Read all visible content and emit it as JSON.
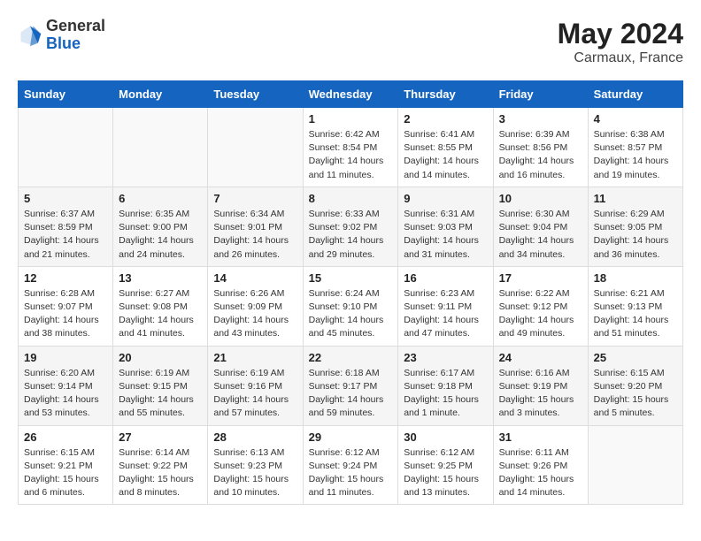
{
  "header": {
    "logo_general": "General",
    "logo_blue": "Blue",
    "month_year": "May 2024",
    "location": "Carmaux, France"
  },
  "weekdays": [
    "Sunday",
    "Monday",
    "Tuesday",
    "Wednesday",
    "Thursday",
    "Friday",
    "Saturday"
  ],
  "weeks": [
    [
      {
        "day": "",
        "info": ""
      },
      {
        "day": "",
        "info": ""
      },
      {
        "day": "",
        "info": ""
      },
      {
        "day": "1",
        "info": "Sunrise: 6:42 AM\nSunset: 8:54 PM\nDaylight: 14 hours\nand 11 minutes."
      },
      {
        "day": "2",
        "info": "Sunrise: 6:41 AM\nSunset: 8:55 PM\nDaylight: 14 hours\nand 14 minutes."
      },
      {
        "day": "3",
        "info": "Sunrise: 6:39 AM\nSunset: 8:56 PM\nDaylight: 14 hours\nand 16 minutes."
      },
      {
        "day": "4",
        "info": "Sunrise: 6:38 AM\nSunset: 8:57 PM\nDaylight: 14 hours\nand 19 minutes."
      }
    ],
    [
      {
        "day": "5",
        "info": "Sunrise: 6:37 AM\nSunset: 8:59 PM\nDaylight: 14 hours\nand 21 minutes."
      },
      {
        "day": "6",
        "info": "Sunrise: 6:35 AM\nSunset: 9:00 PM\nDaylight: 14 hours\nand 24 minutes."
      },
      {
        "day": "7",
        "info": "Sunrise: 6:34 AM\nSunset: 9:01 PM\nDaylight: 14 hours\nand 26 minutes."
      },
      {
        "day": "8",
        "info": "Sunrise: 6:33 AM\nSunset: 9:02 PM\nDaylight: 14 hours\nand 29 minutes."
      },
      {
        "day": "9",
        "info": "Sunrise: 6:31 AM\nSunset: 9:03 PM\nDaylight: 14 hours\nand 31 minutes."
      },
      {
        "day": "10",
        "info": "Sunrise: 6:30 AM\nSunset: 9:04 PM\nDaylight: 14 hours\nand 34 minutes."
      },
      {
        "day": "11",
        "info": "Sunrise: 6:29 AM\nSunset: 9:05 PM\nDaylight: 14 hours\nand 36 minutes."
      }
    ],
    [
      {
        "day": "12",
        "info": "Sunrise: 6:28 AM\nSunset: 9:07 PM\nDaylight: 14 hours\nand 38 minutes."
      },
      {
        "day": "13",
        "info": "Sunrise: 6:27 AM\nSunset: 9:08 PM\nDaylight: 14 hours\nand 41 minutes."
      },
      {
        "day": "14",
        "info": "Sunrise: 6:26 AM\nSunset: 9:09 PM\nDaylight: 14 hours\nand 43 minutes."
      },
      {
        "day": "15",
        "info": "Sunrise: 6:24 AM\nSunset: 9:10 PM\nDaylight: 14 hours\nand 45 minutes."
      },
      {
        "day": "16",
        "info": "Sunrise: 6:23 AM\nSunset: 9:11 PM\nDaylight: 14 hours\nand 47 minutes."
      },
      {
        "day": "17",
        "info": "Sunrise: 6:22 AM\nSunset: 9:12 PM\nDaylight: 14 hours\nand 49 minutes."
      },
      {
        "day": "18",
        "info": "Sunrise: 6:21 AM\nSunset: 9:13 PM\nDaylight: 14 hours\nand 51 minutes."
      }
    ],
    [
      {
        "day": "19",
        "info": "Sunrise: 6:20 AM\nSunset: 9:14 PM\nDaylight: 14 hours\nand 53 minutes."
      },
      {
        "day": "20",
        "info": "Sunrise: 6:19 AM\nSunset: 9:15 PM\nDaylight: 14 hours\nand 55 minutes."
      },
      {
        "day": "21",
        "info": "Sunrise: 6:19 AM\nSunset: 9:16 PM\nDaylight: 14 hours\nand 57 minutes."
      },
      {
        "day": "22",
        "info": "Sunrise: 6:18 AM\nSunset: 9:17 PM\nDaylight: 14 hours\nand 59 minutes."
      },
      {
        "day": "23",
        "info": "Sunrise: 6:17 AM\nSunset: 9:18 PM\nDaylight: 15 hours\nand 1 minute."
      },
      {
        "day": "24",
        "info": "Sunrise: 6:16 AM\nSunset: 9:19 PM\nDaylight: 15 hours\nand 3 minutes."
      },
      {
        "day": "25",
        "info": "Sunrise: 6:15 AM\nSunset: 9:20 PM\nDaylight: 15 hours\nand 5 minutes."
      }
    ],
    [
      {
        "day": "26",
        "info": "Sunrise: 6:15 AM\nSunset: 9:21 PM\nDaylight: 15 hours\nand 6 minutes."
      },
      {
        "day": "27",
        "info": "Sunrise: 6:14 AM\nSunset: 9:22 PM\nDaylight: 15 hours\nand 8 minutes."
      },
      {
        "day": "28",
        "info": "Sunrise: 6:13 AM\nSunset: 9:23 PM\nDaylight: 15 hours\nand 10 minutes."
      },
      {
        "day": "29",
        "info": "Sunrise: 6:12 AM\nSunset: 9:24 PM\nDaylight: 15 hours\nand 11 minutes."
      },
      {
        "day": "30",
        "info": "Sunrise: 6:12 AM\nSunset: 9:25 PM\nDaylight: 15 hours\nand 13 minutes."
      },
      {
        "day": "31",
        "info": "Sunrise: 6:11 AM\nSunset: 9:26 PM\nDaylight: 15 hours\nand 14 minutes."
      },
      {
        "day": "",
        "info": ""
      }
    ]
  ]
}
